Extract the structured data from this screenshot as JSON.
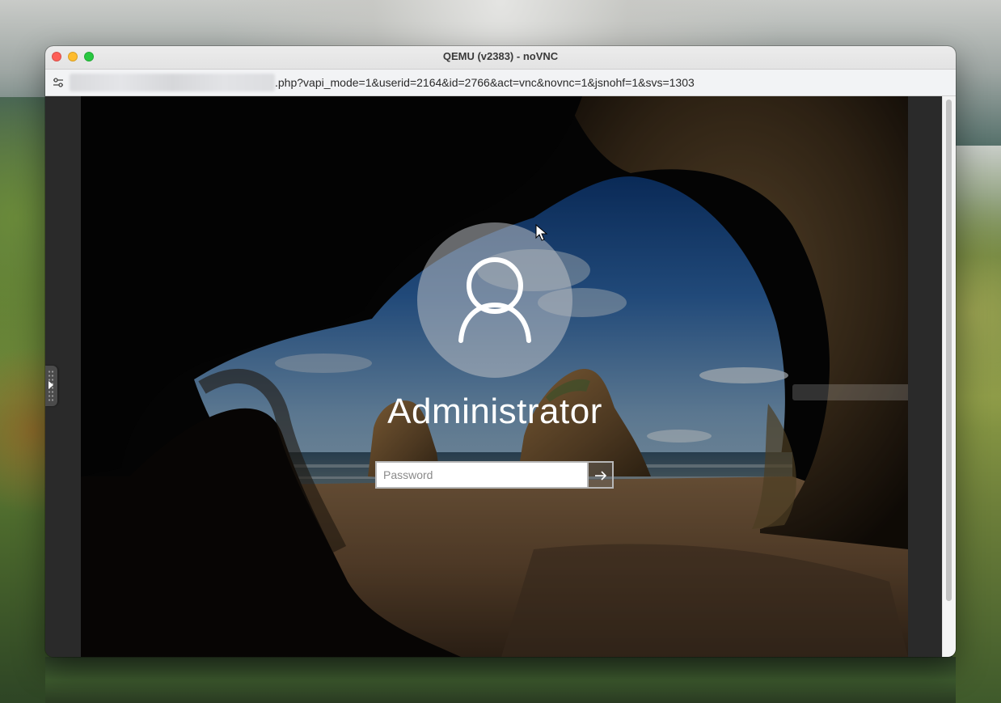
{
  "window": {
    "title": "QEMU (v2383) - noVNC",
    "url_visible": ".php?vapi_mode=1&userid=2164&id=2766&act=vnc&novnc=1&jsnohf=1&svs=1303"
  },
  "login": {
    "username": "Administrator",
    "password_placeholder": "Password",
    "submit_icon": "arrow-right-icon"
  },
  "icons": {
    "site_settings": "sliders-icon",
    "user": "user-avatar-icon",
    "novnc_handle": "play-arrow-icon"
  },
  "colors": {
    "close": "#fe5f57",
    "minimize": "#febc2e",
    "maximize": "#28c840"
  }
}
